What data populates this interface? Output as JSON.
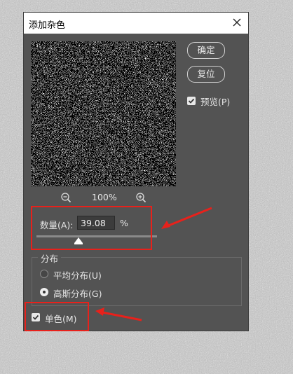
{
  "dialog": {
    "title": "添加杂色",
    "close_icon": "close-icon"
  },
  "buttons": {
    "ok_label": "确定",
    "reset_label": "复位"
  },
  "preview": {
    "checkbox_label": "预览(P)",
    "checked": true,
    "zoom_level": "100%",
    "zoom_out_icon": "zoom-out-icon",
    "zoom_in_icon": "zoom-in-icon"
  },
  "amount": {
    "label": "数量(A):",
    "value": "39.08",
    "unit": "%"
  },
  "distribution": {
    "title": "分布",
    "options": [
      {
        "label": "平均分布(U)",
        "selected": false
      },
      {
        "label": "高斯分布(G)",
        "selected": true
      }
    ]
  },
  "monochrome": {
    "label": "单色(M)",
    "checked": true
  },
  "colors": {
    "dialog_bg": "#535353",
    "annotation": "#e8211b"
  }
}
